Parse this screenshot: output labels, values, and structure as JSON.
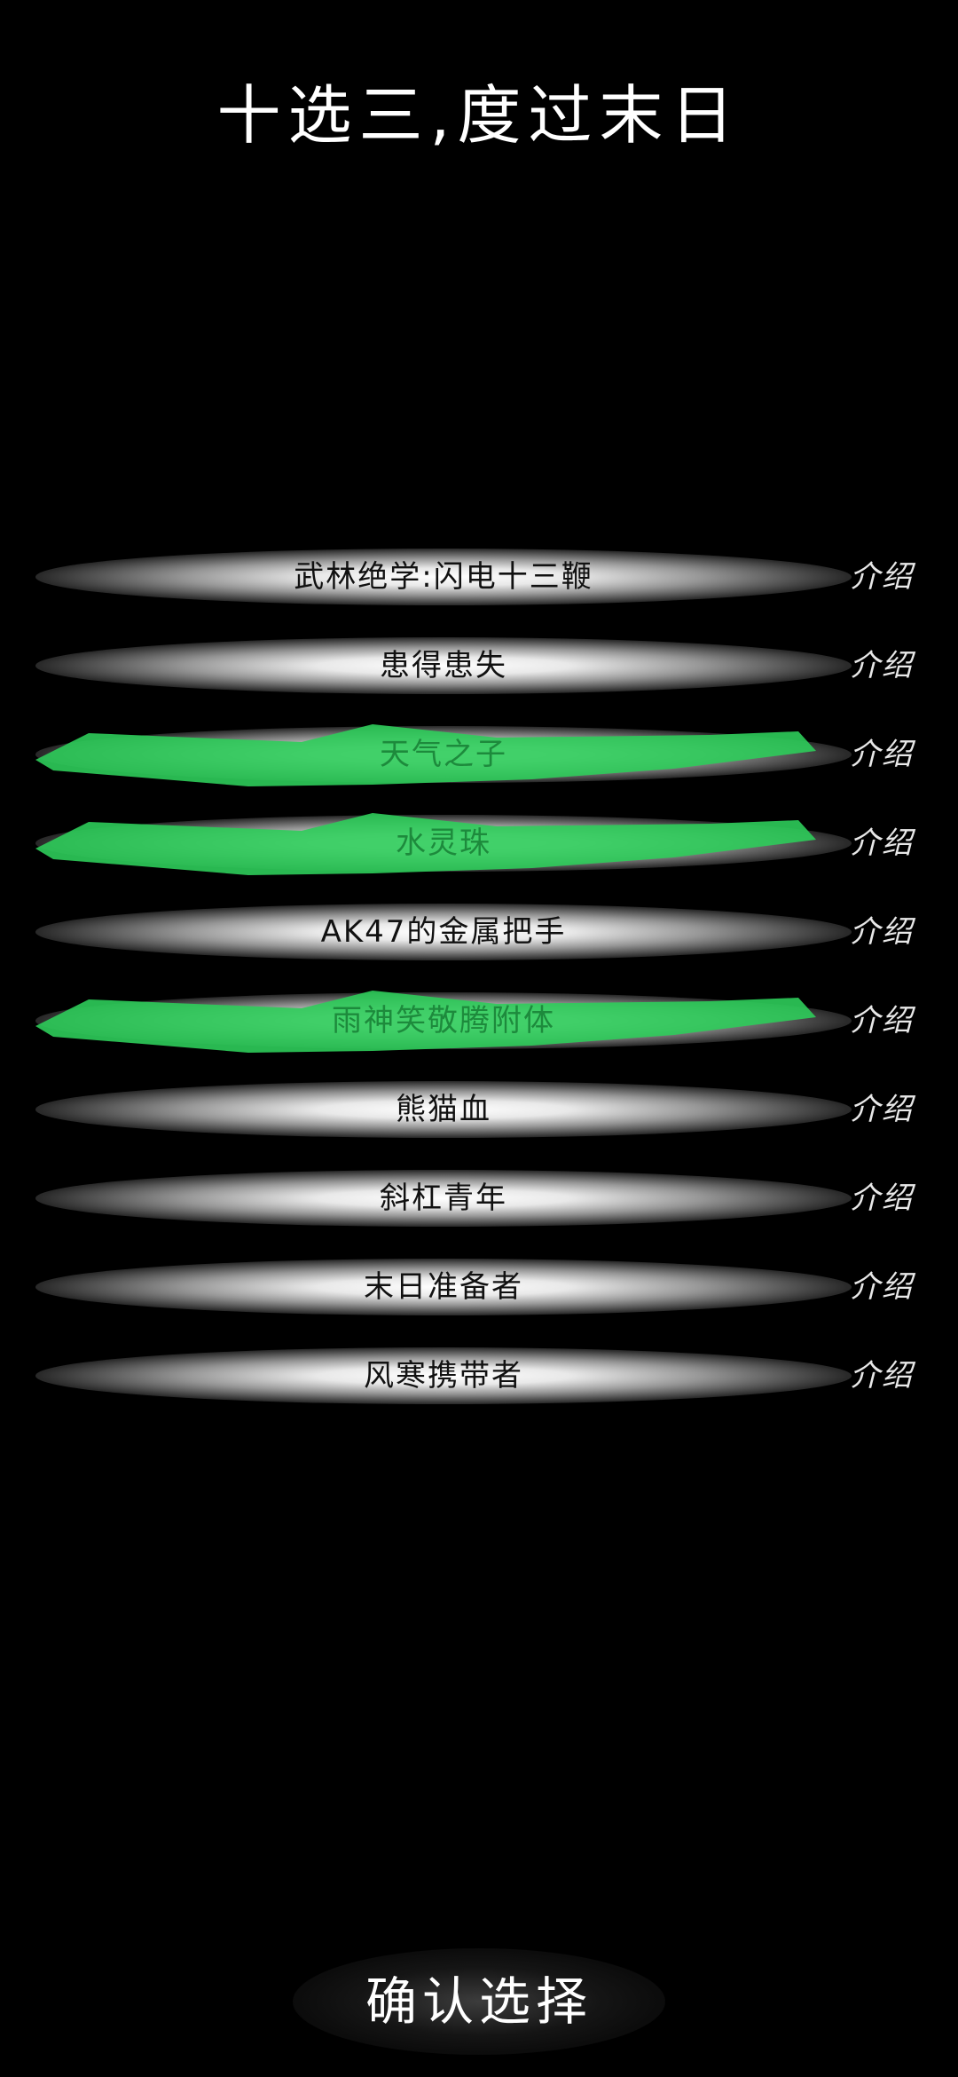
{
  "header": {
    "title": "十选三,度过末日"
  },
  "colors": {
    "background": "#000000",
    "selected_highlight": "#2ecc5a",
    "selected_text": "#1d8a3c",
    "unselected_text": "#111111",
    "intro_text": "#e8e8e8"
  },
  "options": [
    {
      "label": "武林绝学:闪电十三鞭",
      "intro_label": "介绍",
      "selected": false
    },
    {
      "label": "患得患失",
      "intro_label": "介绍",
      "selected": false
    },
    {
      "label": "天气之子",
      "intro_label": "介绍",
      "selected": true
    },
    {
      "label": "水灵珠",
      "intro_label": "介绍",
      "selected": true
    },
    {
      "label": "AK47的金属把手",
      "intro_label": "介绍",
      "selected": false
    },
    {
      "label": "雨神笑敬腾附体",
      "intro_label": "介绍",
      "selected": true
    },
    {
      "label": "熊猫血",
      "intro_label": "介绍",
      "selected": false
    },
    {
      "label": "斜杠青年",
      "intro_label": "介绍",
      "selected": false
    },
    {
      "label": "末日准备者",
      "intro_label": "介绍",
      "selected": false
    },
    {
      "label": "风寒携带者",
      "intro_label": "介绍",
      "selected": false
    }
  ],
  "footer": {
    "confirm_label": "确认选择"
  }
}
